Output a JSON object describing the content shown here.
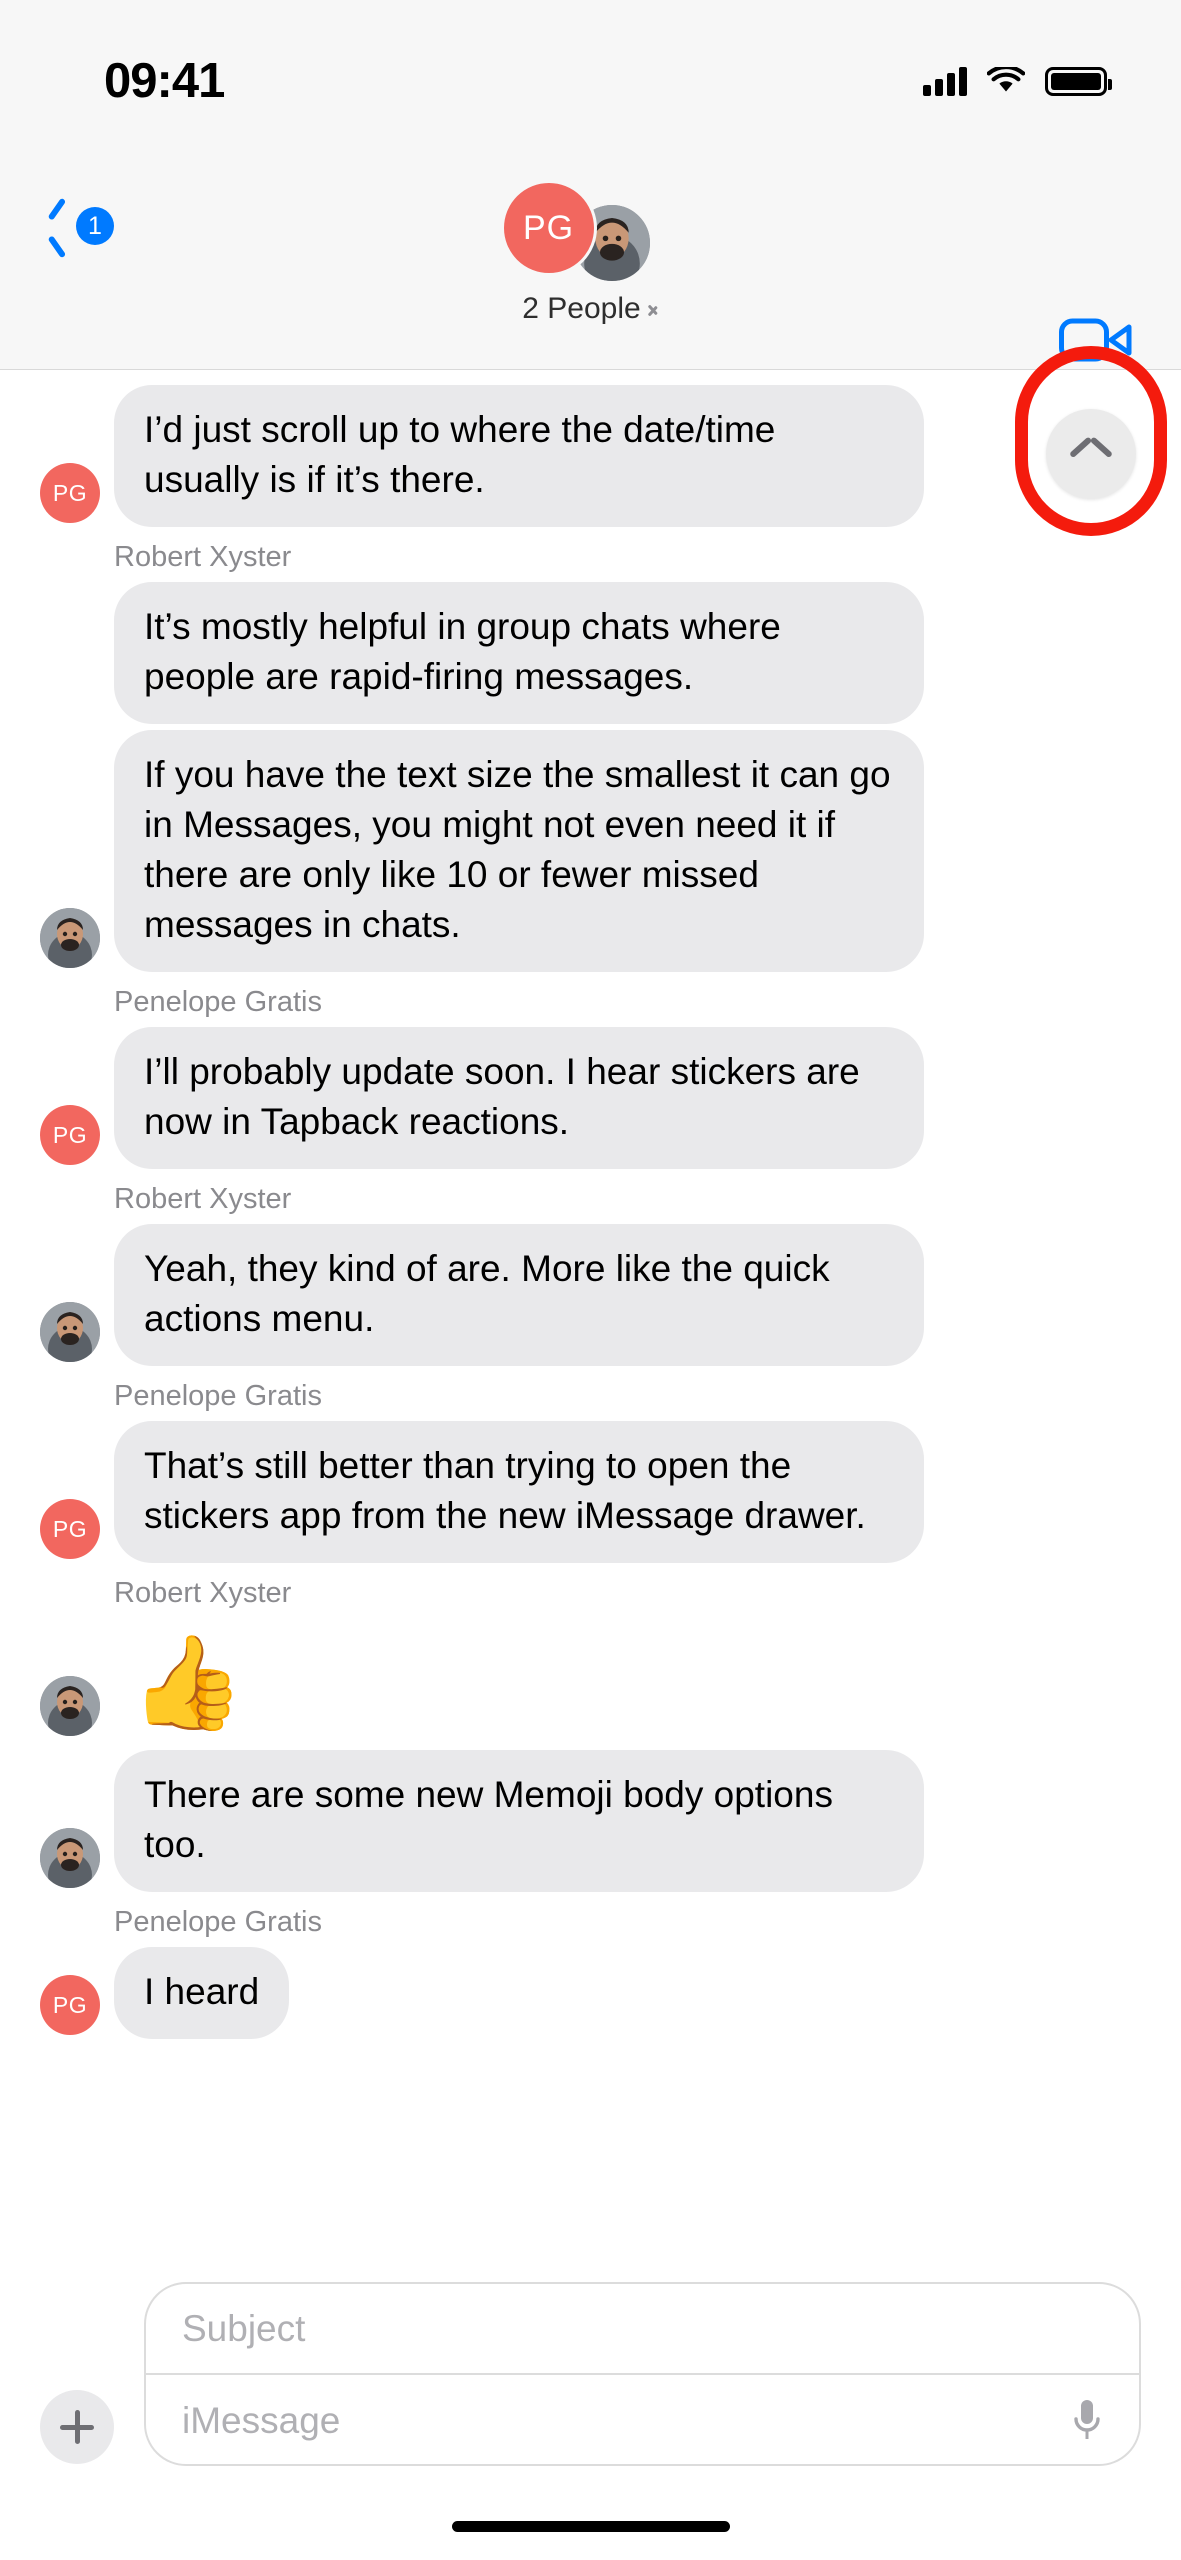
{
  "status_bar": {
    "time": "09:41",
    "signal_icon": "cellular-bars-icon",
    "wifi_icon": "wifi-icon",
    "battery_icon": "battery-full-icon"
  },
  "nav_bar": {
    "back_icon": "chevron-left-icon",
    "unread_count": "1",
    "avatar_initials": "PG",
    "participants_label": "2 People",
    "participants_chevron": "chevron-right-icon",
    "facetime_icon": "video-camera-icon"
  },
  "colors": {
    "accent_blue": "#007aff",
    "bubble_gray": "#e9e9eb",
    "avatar_red": "#f2675f",
    "highlight_red": "#f41b0d",
    "label_gray": "#8a8a8e"
  },
  "scroll_button": {
    "icon": "chevron-up-icon",
    "name": "scroll-to-top-button"
  },
  "conversation": [
    {
      "type": "message",
      "sender": "PG",
      "avatar": "pg",
      "text": "I’d just scroll up to where the date/time usually is if it’s there."
    },
    {
      "type": "label",
      "text": "Robert Xyster"
    },
    {
      "type": "message",
      "sender": "RX",
      "avatar": "spacer",
      "text": "It’s mostly helpful in group chats where people are rapid-firing messages."
    },
    {
      "type": "message",
      "sender": "RX",
      "avatar": "rx",
      "text": "If you have the text size the smallest it can go in Messages, you might not even need it if there are only like 10 or fewer missed messages in chats."
    },
    {
      "type": "label",
      "text": "Penelope Gratis"
    },
    {
      "type": "message",
      "sender": "PG",
      "avatar": "pg",
      "text": "I’ll probably update soon. I hear stickers are now in Tapback reactions."
    },
    {
      "type": "label",
      "text": "Robert Xyster"
    },
    {
      "type": "message",
      "sender": "RX",
      "avatar": "rx",
      "text": "Yeah, they kind of are. More like the quick actions menu."
    },
    {
      "type": "label",
      "text": "Penelope Gratis"
    },
    {
      "type": "message",
      "sender": "PG",
      "avatar": "pg",
      "text": "That’s still better than trying to open the stickers app from the new iMessage drawer."
    },
    {
      "type": "label",
      "text": "Robert Xyster"
    },
    {
      "type": "emoji",
      "sender": "RX",
      "avatar": "rx",
      "text": "👍"
    },
    {
      "type": "message",
      "sender": "RX",
      "avatar": "rx",
      "text": "There are some new Memoji body options too."
    },
    {
      "type": "label",
      "text": "Penelope Gratis"
    },
    {
      "type": "message",
      "sender": "PG",
      "avatar": "pg",
      "text": "I heard"
    }
  ],
  "composer": {
    "plus_icon": "plus-icon",
    "subject_placeholder": "Subject",
    "message_placeholder": "iMessage",
    "mic_icon": "microphone-icon"
  }
}
